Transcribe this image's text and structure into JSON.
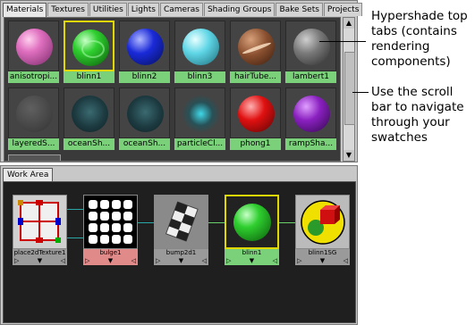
{
  "tabs": [
    "Materials",
    "Textures",
    "Utilities",
    "Lights",
    "Cameras",
    "Shading Groups",
    "Bake Sets",
    "Projects"
  ],
  "swatches": [
    {
      "label": "anisotropi...",
      "kind": "pink"
    },
    {
      "label": "blinn1",
      "kind": "green",
      "selected": true
    },
    {
      "label": "blinn2",
      "kind": "blue"
    },
    {
      "label": "blinn3",
      "kind": "cyan"
    },
    {
      "label": "hairTube...",
      "kind": "brown"
    },
    {
      "label": "lambert1",
      "kind": "gray"
    },
    {
      "label": "layeredS...",
      "kind": "checker"
    },
    {
      "label": "oceanSh...",
      "kind": "ocean"
    },
    {
      "label": "oceanSh...",
      "kind": "ocean"
    },
    {
      "label": "particleCl...",
      "kind": "particle"
    },
    {
      "label": "phong1",
      "kind": "red"
    },
    {
      "label": "rampSha...",
      "kind": "purple"
    }
  ],
  "annotations": {
    "tabs_note": "Hypershade top tabs (contains rendering components)",
    "scroll_note": "Use the scroll bar to navigate through your swatches"
  },
  "work_area": {
    "tab_label": "Work Area",
    "nodes": [
      {
        "label": "place2dTexture1",
        "kind": "place2d"
      },
      {
        "label": "bulge1",
        "kind": "bulge"
      },
      {
        "label": "bump2d1",
        "kind": "bump"
      },
      {
        "label": "blinn1",
        "kind": "green"
      },
      {
        "label": "blinn1SG",
        "kind": "sg"
      }
    ]
  },
  "icons": {
    "scroll_up": "▲",
    "scroll_down": "▼",
    "node_left": "▷",
    "node_mid": "▼",
    "node_right": "◁"
  },
  "colors": {
    "label_green": "#7ad17a",
    "selected_border": "#e0d800",
    "bulge_label": "#e08a8a",
    "node_label_gray": "#9a9a9a"
  }
}
